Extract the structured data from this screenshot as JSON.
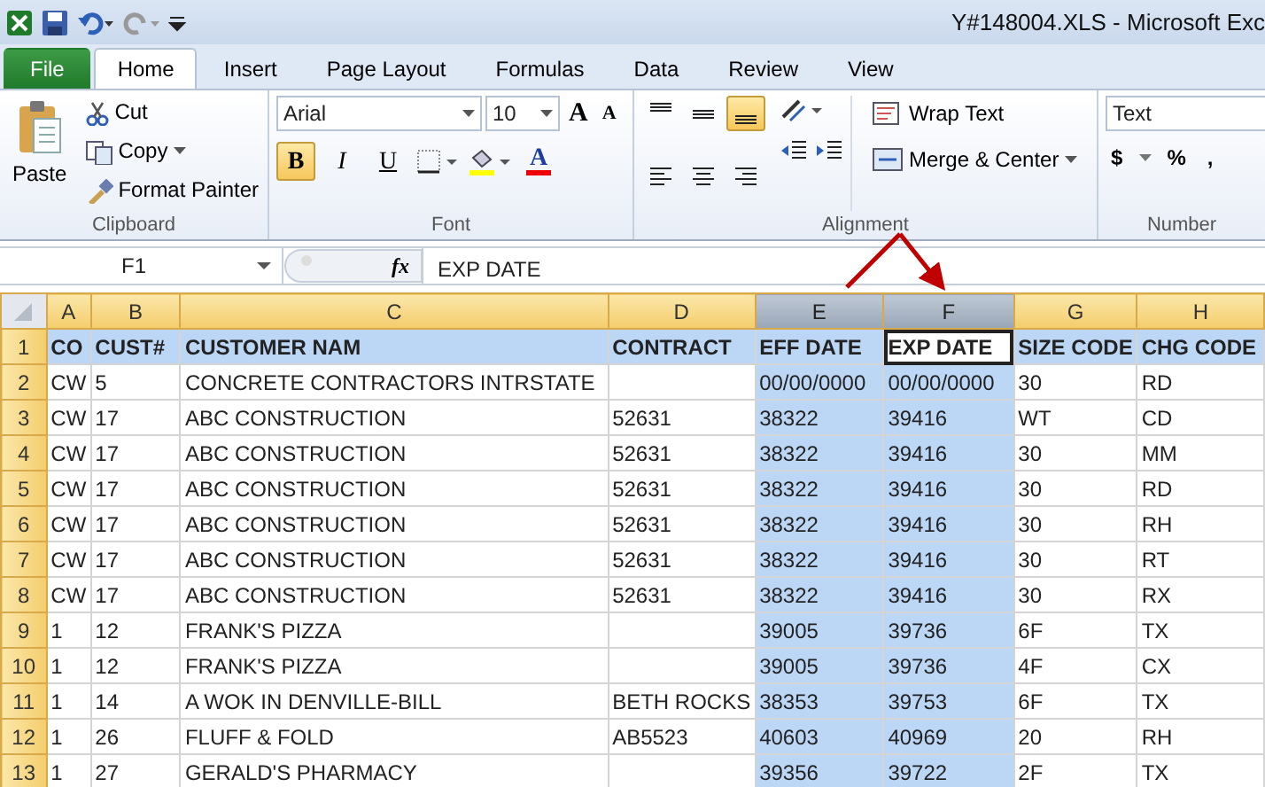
{
  "window": {
    "title": "Y#148004.XLS  -  Microsoft Exc"
  },
  "tabs": [
    {
      "label": "File",
      "kind": "file",
      "selected": false
    },
    {
      "label": "Home",
      "kind": "tab",
      "selected": true
    },
    {
      "label": "Insert",
      "kind": "tab",
      "selected": false
    },
    {
      "label": "Page Layout",
      "kind": "tab",
      "selected": false
    },
    {
      "label": "Formulas",
      "kind": "tab",
      "selected": false
    },
    {
      "label": "Data",
      "kind": "tab",
      "selected": false
    },
    {
      "label": "Review",
      "kind": "tab",
      "selected": false
    },
    {
      "label": "View",
      "kind": "tab",
      "selected": false
    }
  ],
  "ribbon": {
    "clipboard": {
      "label": "Clipboard",
      "paste": "Paste",
      "cut": "Cut",
      "copy": "Copy",
      "format_painter": "Format Painter"
    },
    "font": {
      "label": "Font",
      "font_name": "Arial",
      "font_size": "10",
      "grow": "A",
      "shrink": "A",
      "font_color": "A",
      "styles": [
        {
          "label": "B",
          "kind": "bold",
          "selected": true
        },
        {
          "label": "I",
          "kind": "italic",
          "selected": false
        },
        {
          "label": "U",
          "kind": "underline",
          "selected": false
        }
      ]
    },
    "alignment": {
      "label": "Alignment",
      "vertical": [
        {
          "kind": "top",
          "selected": false
        },
        {
          "kind": "middle",
          "selected": false
        },
        {
          "kind": "bottom",
          "selected": true
        }
      ],
      "wrap_text": "Wrap Text",
      "merge_center": "Merge & Center"
    },
    "number": {
      "label": "Number",
      "format": "Text",
      "currency": "$",
      "percent": "%",
      "comma": ","
    }
  },
  "formula_bar": {
    "name_box": "F1",
    "fx": "fx",
    "value": "EXP DATE"
  },
  "sheet": {
    "columns": [
      {
        "letter": "A",
        "selected": false,
        "active": false
      },
      {
        "letter": "B",
        "selected": false,
        "active": false
      },
      {
        "letter": "C",
        "selected": false,
        "active": false
      },
      {
        "letter": "D",
        "selected": false,
        "active": false
      },
      {
        "letter": "E",
        "selected": true,
        "active": false
      },
      {
        "letter": "F",
        "selected": true,
        "active": true
      },
      {
        "letter": "G",
        "selected": false,
        "active": false
      },
      {
        "letter": "H",
        "selected": false,
        "active": false
      }
    ],
    "rows": [
      {
        "number": "1",
        "kind": "header",
        "active": true,
        "cells": [
          "CO",
          "CUST#",
          "CUSTOMER NAM",
          "CONTRACT",
          "EFF DATE",
          "EXP DATE",
          "SIZE CODE",
          "CHG CODE"
        ]
      },
      {
        "number": "2",
        "kind": "data",
        "active": false,
        "cells": [
          "CW",
          "5",
          "CONCRETE CONTRACTORS INTRSTATE",
          "",
          "00/00/0000",
          "00/00/0000",
          "30",
          "RD"
        ]
      },
      {
        "number": "3",
        "kind": "data",
        "active": false,
        "cells": [
          "CW",
          "17",
          "ABC CONSTRUCTION",
          "52631",
          "38322",
          "39416",
          "WT",
          "CD"
        ]
      },
      {
        "number": "4",
        "kind": "data",
        "active": false,
        "cells": [
          "CW",
          "17",
          "ABC CONSTRUCTION",
          "52631",
          "38322",
          "39416",
          "30",
          "MM"
        ]
      },
      {
        "number": "5",
        "kind": "data",
        "active": false,
        "cells": [
          "CW",
          "17",
          "ABC CONSTRUCTION",
          "52631",
          "38322",
          "39416",
          "30",
          "RD"
        ]
      },
      {
        "number": "6",
        "kind": "data",
        "active": false,
        "cells": [
          "CW",
          "17",
          "ABC CONSTRUCTION",
          "52631",
          "38322",
          "39416",
          "30",
          "RH"
        ]
      },
      {
        "number": "7",
        "kind": "data",
        "active": false,
        "cells": [
          "CW",
          "17",
          "ABC CONSTRUCTION",
          "52631",
          "38322",
          "39416",
          "30",
          "RT"
        ]
      },
      {
        "number": "8",
        "kind": "data",
        "active": false,
        "cells": [
          "CW",
          "17",
          "ABC CONSTRUCTION",
          "52631",
          "38322",
          "39416",
          "30",
          "RX"
        ]
      },
      {
        "number": "9",
        "kind": "data",
        "active": false,
        "cells": [
          "1",
          "12",
          "FRANK'S PIZZA",
          "",
          "39005",
          "39736",
          "6F",
          "TX"
        ]
      },
      {
        "number": "10",
        "kind": "data",
        "active": false,
        "cells": [
          "1",
          "12",
          "FRANK'S PIZZA",
          "",
          "39005",
          "39736",
          "4F",
          "CX"
        ]
      },
      {
        "number": "11",
        "kind": "data",
        "active": false,
        "cells": [
          "1",
          "14",
          "A WOK IN DENVILLE-BILL",
          "BETH ROCKS",
          "38353",
          "39753",
          "6F",
          "TX"
        ]
      },
      {
        "number": "12",
        "kind": "data",
        "active": false,
        "cells": [
          "1",
          "26",
          "FLUFF & FOLD",
          "AB5523",
          "40603",
          "40969",
          "20",
          "RH"
        ]
      },
      {
        "number": "13",
        "kind": "data",
        "active": false,
        "cells": [
          "1",
          "27",
          "GERALD'S PHARMACY",
          "",
          "39356",
          "39722",
          "2F",
          "TX"
        ]
      }
    ]
  }
}
